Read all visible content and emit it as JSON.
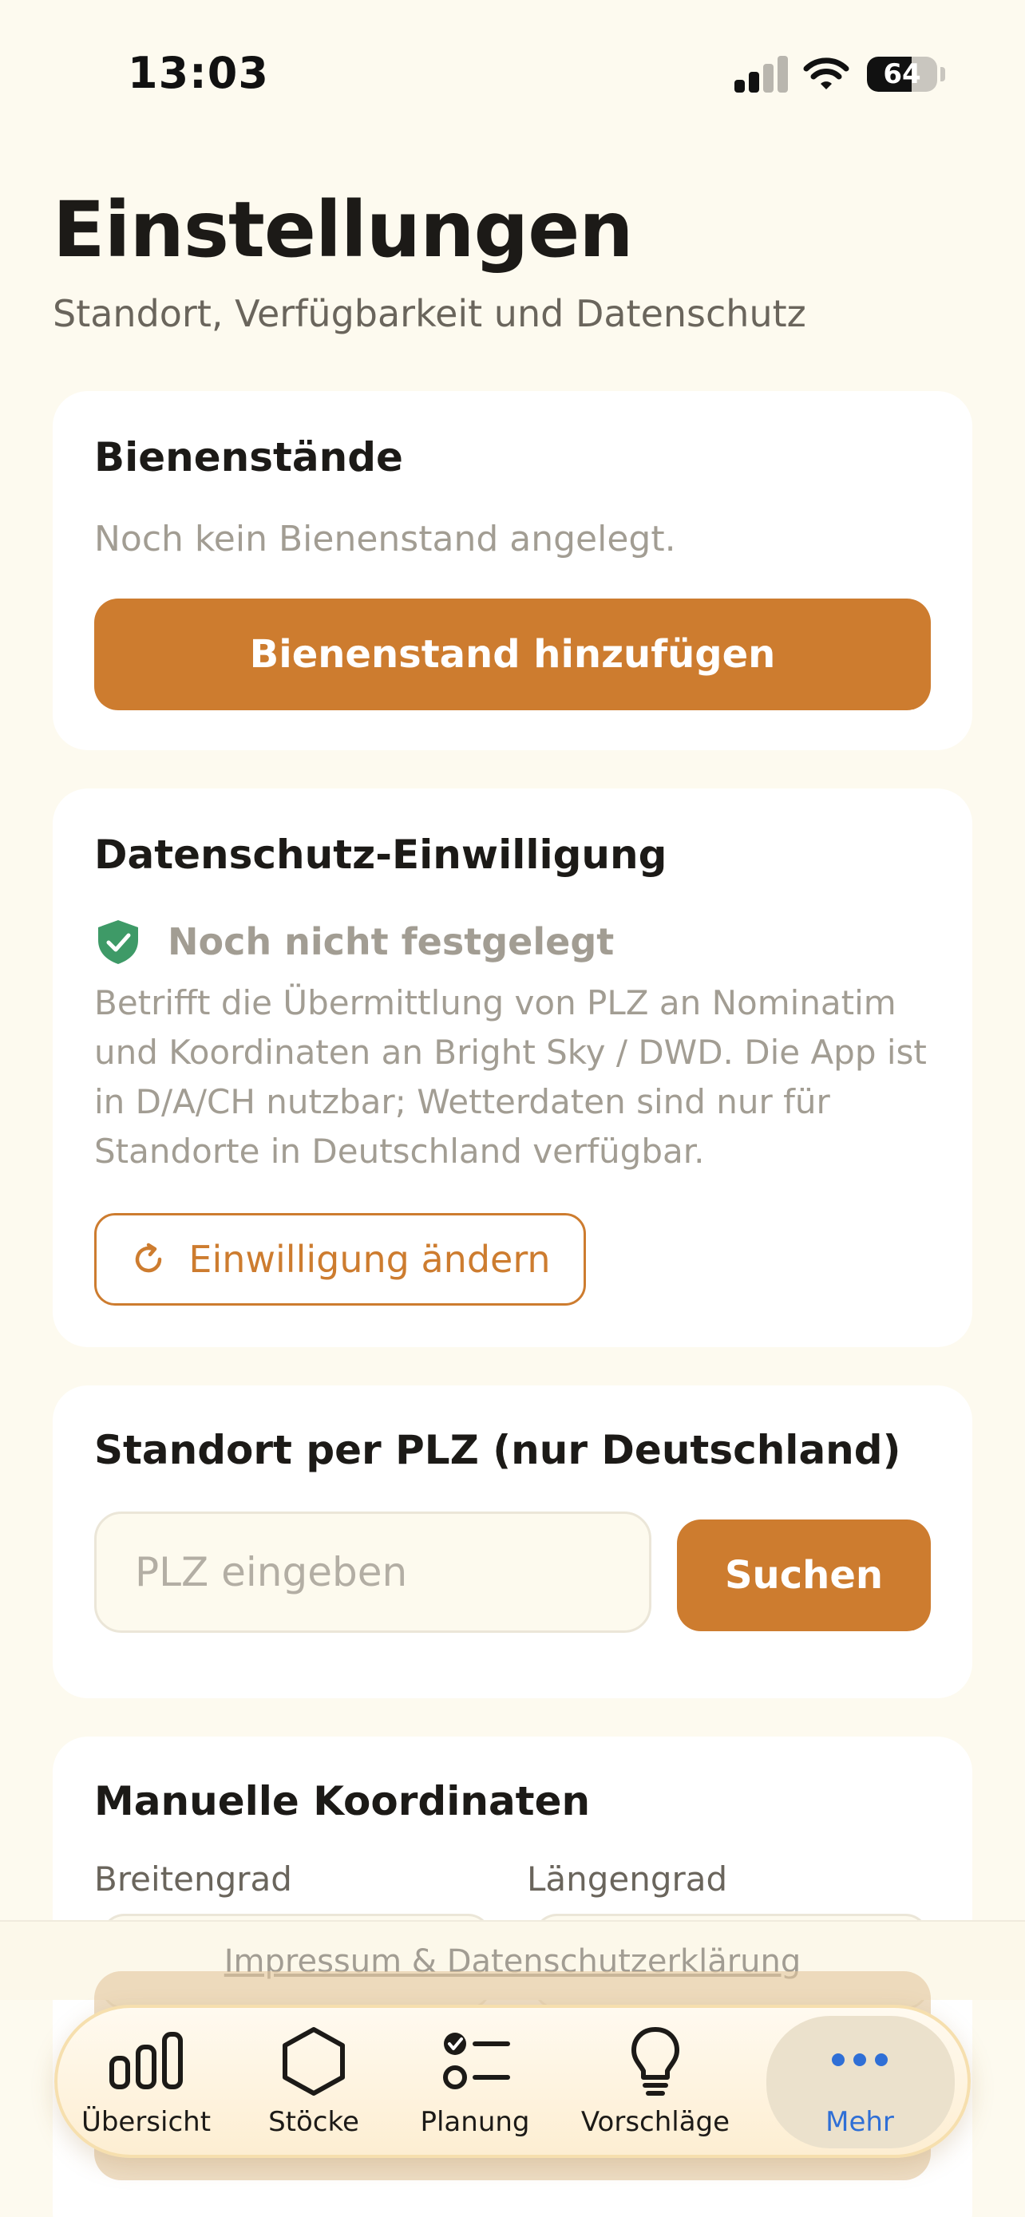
{
  "status_bar": {
    "time": "13:03",
    "battery_level": "64",
    "battery_fraction": 0.64
  },
  "header": {
    "title": "Einstellungen",
    "subtitle": "Standort, Verfügbarkeit und Datenschutz"
  },
  "apiaries": {
    "title": "Bienenstände",
    "empty_text": "Noch kein Bienenstand angelegt.",
    "add_button": "Bienenstand hinzufügen"
  },
  "privacy": {
    "title": "Datenschutz-Einwilligung",
    "status": "Noch nicht festgelegt",
    "status_color": "#3e9a67",
    "description": "Betrifft die Übermittlung von PLZ an Nominatim und Koordinaten an Bright Sky / DWD. Die App ist in D/A/CH nutzbar; Wetterdaten sind nur für Standorte in Deutschland verfügbar.",
    "change_button": "Einwilligung ändern"
  },
  "location_plz": {
    "title": "Standort per PLZ (nur Deutschland)",
    "input_value": "",
    "input_placeholder": "PLZ eingeben",
    "search_button": "Suchen"
  },
  "manual_coords": {
    "title": "Manuelle Koordinaten",
    "latitude_label": "Breitengrad",
    "longitude_label": "Längengrad"
  },
  "footer": {
    "impressum_link": "Impressum & Datenschutzerklärung"
  },
  "tab_bar": {
    "items": [
      {
        "label": "Übersicht",
        "icon": "bar-chart-icon"
      },
      {
        "label": "Stöcke",
        "icon": "hexagon-icon"
      },
      {
        "label": "Planung",
        "icon": "checklist-icon"
      },
      {
        "label": "Vorschläge",
        "icon": "lightbulb-icon"
      },
      {
        "label": "Mehr",
        "icon": "more-dots-icon",
        "active": true
      }
    ]
  },
  "colors": {
    "accent": "#cd7c2f",
    "background": "#fdfaef",
    "active_tab": "#2f6fd6"
  }
}
